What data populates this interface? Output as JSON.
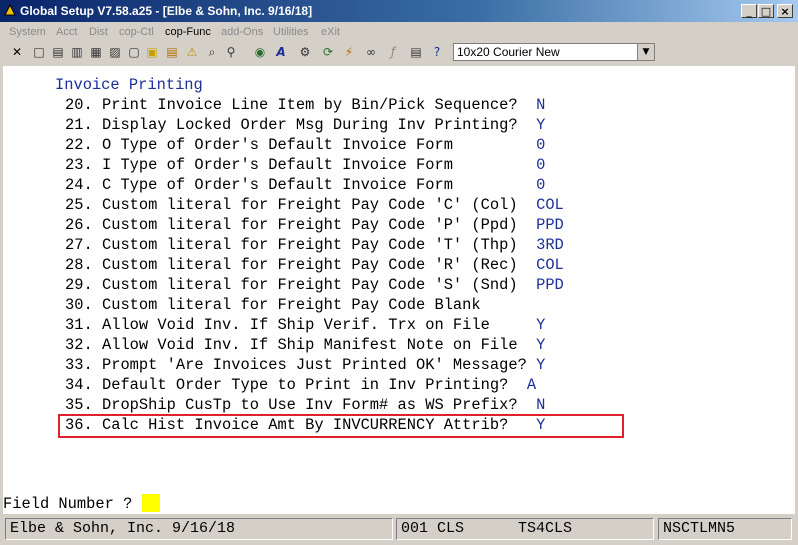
{
  "window": {
    "title": "Global Setup V7.58.a25 - [Elbe & Sohn, Inc. 9/16/18]",
    "minimize": "_",
    "maximize": "□",
    "close": "×"
  },
  "menu": [
    {
      "label": "System",
      "active": false
    },
    {
      "label": "Acct",
      "active": false
    },
    {
      "label": "Dist",
      "active": false
    },
    {
      "label": "cop-Ctl",
      "active": false
    },
    {
      "label": "cop-Func",
      "active": true
    },
    {
      "label": "add-Ons",
      "active": false
    },
    {
      "label": "Utilities",
      "active": false
    },
    {
      "label": "eXit",
      "active": false
    }
  ],
  "toolbar": {
    "font_select": "10x20 Courier New"
  },
  "screen": {
    "title": "Invoice Printing",
    "rows": [
      {
        "num": "20.",
        "label": "Print Invoice Line Item by Bin/Pick Sequence?",
        "value": "N"
      },
      {
        "num": "21.",
        "label": "Display Locked Order Msg During Inv Printing?",
        "value": "Y"
      },
      {
        "num": "22.",
        "label": "O Type of Order's Default Invoice Form",
        "value": "0"
      },
      {
        "num": "23.",
        "label": "I Type of Order's Default Invoice Form",
        "value": "0"
      },
      {
        "num": "24.",
        "label": "C Type of Order's Default Invoice Form",
        "value": "0"
      },
      {
        "num": "25.",
        "label": "Custom literal for Freight Pay Code 'C' (Col)",
        "value": "COL"
      },
      {
        "num": "26.",
        "label": "Custom literal for Freight Pay Code 'P' (Ppd)",
        "value": "PPD"
      },
      {
        "num": "27.",
        "label": "Custom literal for Freight Pay Code 'T' (Thp)",
        "value": "3RD"
      },
      {
        "num": "28.",
        "label": "Custom literal for Freight Pay Code 'R' (Rec)",
        "value": "COL"
      },
      {
        "num": "29.",
        "label": "Custom literal for Freight Pay Code 'S' (Snd)",
        "value": "PPD"
      },
      {
        "num": "30.",
        "label": "Custom literal for Freight Pay Code Blank",
        "value": ""
      },
      {
        "num": "31.",
        "label": "Allow Void Inv. If Ship Verif. Trx on File",
        "value": "Y"
      },
      {
        "num": "32.",
        "label": "Allow Void Inv. If Ship Manifest Note on File",
        "value": "Y"
      },
      {
        "num": "33.",
        "label": "Prompt 'Are Invoices Just Printed OK' Message?",
        "value": "Y"
      },
      {
        "num": "34.",
        "label": "Default Order Type to Print in Inv Printing?",
        "value": "A"
      },
      {
        "num": "35.",
        "label": "DropShip CusTp to Use Inv Form# as WS Prefix?",
        "value": "N"
      },
      {
        "num": "36.",
        "label": "Calc Hist Invoice Amt By INVCURRENCY Attrib?",
        "value": "Y"
      }
    ],
    "prompt": "Field Number ? "
  },
  "status": {
    "company": "Elbe & Sohn, Inc. 9/16/18",
    "company_code": "001 CLS",
    "terminal": "TS4CLS",
    "program": "NSCTLMN5"
  },
  "colors": {
    "value_text": "#1b2f9b",
    "highlight_border": "#e0202a",
    "cursor": "#ffff00"
  }
}
